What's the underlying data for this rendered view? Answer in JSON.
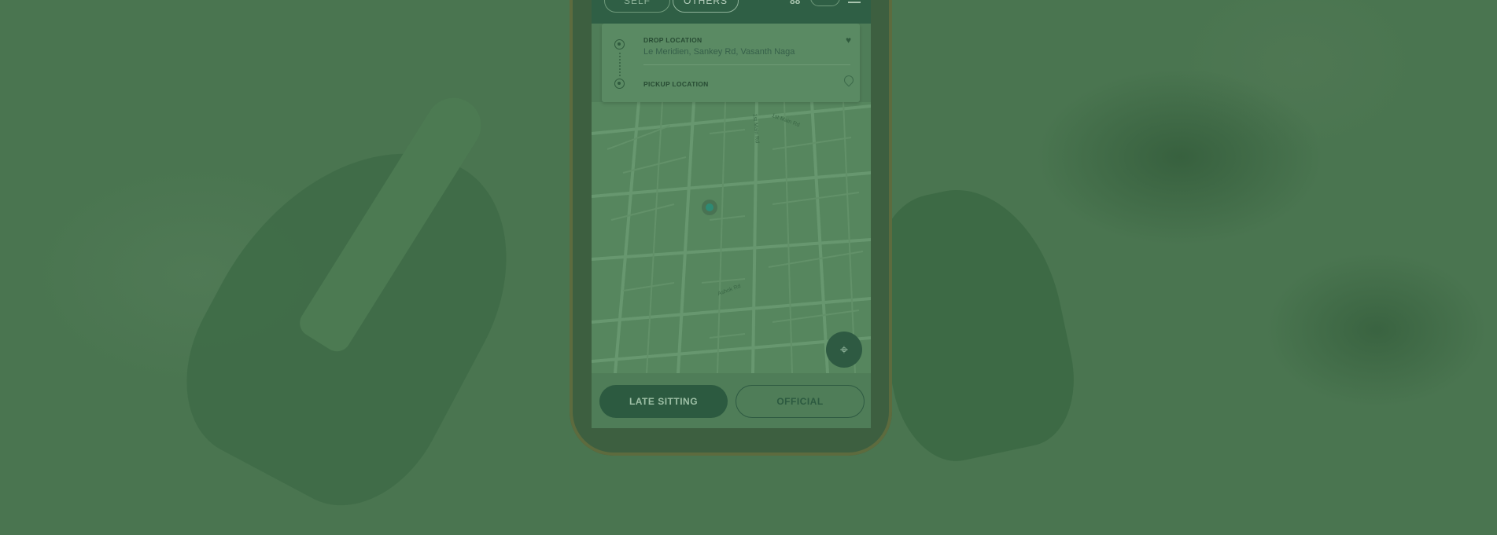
{
  "tabs": {
    "self_label": "SELF",
    "others_label": "OTHERS"
  },
  "header": {
    "glyph": "88"
  },
  "drop": {
    "label": "DROP LOCATION",
    "address": "Le Meridien, Sankey Rd, Vasanth Naga"
  },
  "pickup": {
    "label": "PICKUP LOCATION"
  },
  "map": {
    "street_labels": [
      "1st Main Rd",
      "1st Main Rd",
      "Ashok Rd"
    ]
  },
  "buttons": {
    "late_sitting": "LATE SITTING",
    "official": "OFFICIAL"
  },
  "colors": {
    "accent": "#2c5a40",
    "overlay": "#4a7550"
  },
  "icons": {
    "locate": "crosshair-icon",
    "favorite": "heart-icon",
    "pin": "location-pin-icon"
  }
}
